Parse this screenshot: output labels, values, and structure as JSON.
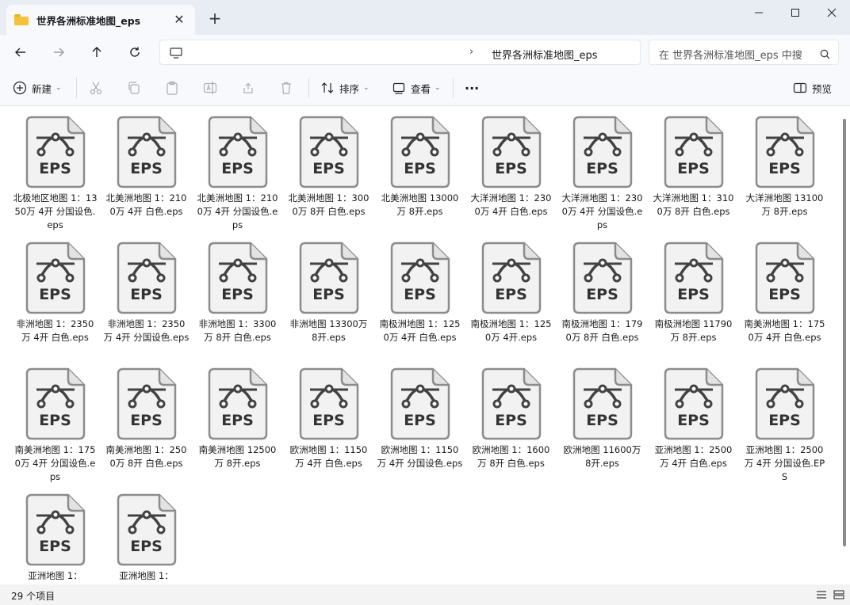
{
  "window": {
    "tab_title": "世界各洲标准地图_eps",
    "close_tab": "✕",
    "new_tab": "+"
  },
  "navigation": {
    "address_path": "世界各洲标准地图_eps",
    "search_placeholder": "在 世界各洲标准地图_eps 中搜"
  },
  "toolbar": {
    "new_label": "新建",
    "sort_label": "排序",
    "view_label": "查看",
    "more_label": "···",
    "preview_label": "预览"
  },
  "files": [
    {
      "name": "北极地区地图 1：1350万 4开 分国设色.eps"
    },
    {
      "name": "北美洲地图 1：2100万 4开 白色.eps"
    },
    {
      "name": "北美洲地图 1：2100万 4开 分国设色.eps"
    },
    {
      "name": "北美洲地图 1：3000万 8开 白色.eps"
    },
    {
      "name": "北美洲地图 13000万 8开.eps"
    },
    {
      "name": "大洋洲地图 1：2300万 4开 白色.eps"
    },
    {
      "name": "大洋洲地图 1：2300万 4开 分国设色.eps"
    },
    {
      "name": "大洋洲地图 1：3100万 8开 白色.eps"
    },
    {
      "name": "大洋洲地图 13100万 8开.eps"
    },
    {
      "name": "非洲地图 1：2350万 4开 白色.eps"
    },
    {
      "name": "非洲地图 1：2350万 4开 分国设色.eps"
    },
    {
      "name": "非洲地图 1：3300万 8开 白色.eps"
    },
    {
      "name": "非洲地图 13300万 8开.eps"
    },
    {
      "name": "南极洲地图 1：1250万 4开 白色.eps"
    },
    {
      "name": "南极洲地图 1：1250万 4开.eps"
    },
    {
      "name": "南极洲地图 1：1790万 8开 白色.eps"
    },
    {
      "name": "南极洲地图 11790万 8开.eps"
    },
    {
      "name": "南美洲地图 1：1750万 4开 白色.eps"
    },
    {
      "name": "南美洲地图 1：1750万 4开 分国设色.eps"
    },
    {
      "name": "南美洲地图 1：2500万 8开 白色.eps"
    },
    {
      "name": "南美洲地图 12500万 8开.eps"
    },
    {
      "name": "欧洲地图 1：1150万 4开 白色.eps"
    },
    {
      "name": "欧洲地图 1：1150万 4开 分国设色.eps"
    },
    {
      "name": "欧洲地图 1：1600万 8开 白色.eps"
    },
    {
      "name": "欧洲地图 11600万 8开.eps"
    },
    {
      "name": "亚洲地图 1：2500万 4开 白色.eps"
    },
    {
      "name": "亚洲地图 1：2500万 4开 分国设色.EPS"
    },
    {
      "name": "亚洲地图 1："
    },
    {
      "name": "亚洲地图 1："
    }
  ],
  "file_icon_label": "EPS",
  "status": {
    "item_count": "29 个项目"
  },
  "colors": {
    "accent_folder": "#f5c33b",
    "icon_gray": "#424242",
    "icon_fill": "#f2f2f2"
  }
}
